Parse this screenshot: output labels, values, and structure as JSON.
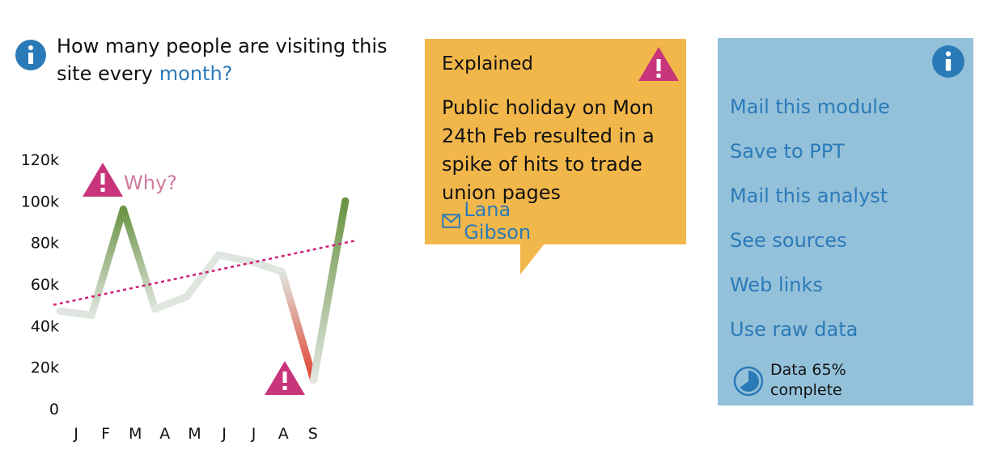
{
  "question": {
    "text": "How many people are visiting this site every",
    "link": "month?",
    "icon": "info-icon"
  },
  "chart_data": {
    "type": "line",
    "title": "",
    "xlabel": "",
    "ylabel": "",
    "categories": [
      "J",
      "F",
      "M",
      "A",
      "M",
      "J",
      "J",
      "A",
      "S"
    ],
    "x": [
      0,
      1,
      2,
      3,
      4,
      5,
      6,
      7,
      8,
      9
    ],
    "values": [
      47000,
      45000,
      96000,
      48000,
      54000,
      74000,
      71000,
      66000,
      14000,
      100000
    ],
    "ylim": [
      0,
      120000
    ],
    "yticks": [
      "0",
      "20k",
      "40k",
      "60k",
      "80k",
      "100k",
      "120k"
    ],
    "trendline": {
      "start": 50000,
      "end": 81000
    },
    "grid": false,
    "annotations": [
      {
        "label": "Why?",
        "x": 2,
        "icon": "warning-icon"
      },
      {
        "label": "",
        "x": 8,
        "icon": "warning-icon"
      }
    ],
    "colors": {
      "line_base": "#dfe5df",
      "line_peak": "#6a9444",
      "line_dip": "#e0432f",
      "trend": "#cf1f78",
      "warning": "#c8357a",
      "annotation_text": "#d07aa0"
    }
  },
  "callout": {
    "title": "Explained",
    "body": "Public holiday on Mon 24th Feb resulted in a spike of hits to trade union pages",
    "contact": "Lana Gibson",
    "contact_icon": "mail-icon",
    "icon": "warning-icon",
    "background": "#f2b74a"
  },
  "panel": {
    "background": "#94c1da",
    "info_icon": "info-icon",
    "items": [
      {
        "label": "Mail this module"
      },
      {
        "label": "Save to PPT"
      },
      {
        "label": "Mail this analyst"
      },
      {
        "label": "See sources"
      },
      {
        "label": "Web links"
      },
      {
        "label": "Use raw data"
      }
    ],
    "progress": {
      "percent": 65,
      "line1": "Data 65%",
      "line2": "complete",
      "icon": "pie-progress-icon"
    }
  },
  "accent": "#2b7ab8"
}
